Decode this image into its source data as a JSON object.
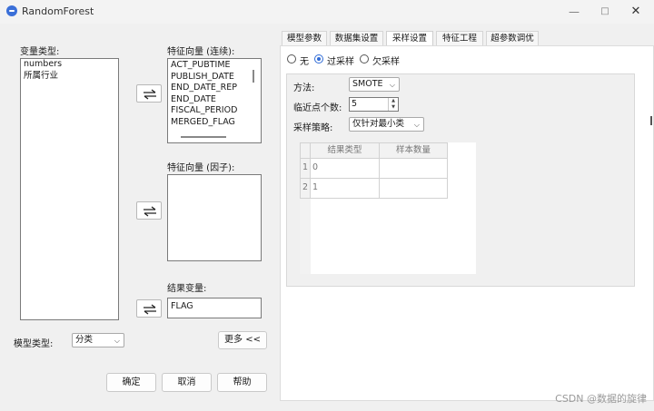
{
  "window": {
    "title": "RandomForest",
    "min_glyph": "—",
    "max_glyph": "□",
    "close_glyph": "✕"
  },
  "left": {
    "var_type_label": "变量类型:",
    "var_types": [
      "numbers",
      "所属行业"
    ],
    "continuous_label": "特征向量 (连续):",
    "continuous_items": [
      "ACT_PUBTIME",
      "PUBLISH_DATE",
      "END_DATE_REP",
      "END_DATE",
      "FISCAL_PERIOD",
      "MERGED_FLAG"
    ],
    "factor_label": "特征向量 (因子):",
    "result_label": "结果变量:",
    "result_value": "FLAG",
    "model_type_label": "模型类型:",
    "model_type_value": "分类",
    "more_button": "更多 <<",
    "ok_button": "确定",
    "cancel_button": "取消",
    "help_button": "帮助"
  },
  "tabs": [
    "模型参数",
    "数据集设置",
    "采样设置",
    "特征工程",
    "超参数调优"
  ],
  "active_tab": "采样设置",
  "sampling": {
    "radio_none": "无",
    "radio_over": "过采样",
    "radio_under": "欠采样",
    "selected": "过采样",
    "method_label": "方法:",
    "method_value": "SMOTE",
    "neighbors_label": "临近点个数:",
    "neighbors_value": "5",
    "strategy_label": "采样策略:",
    "strategy_value": "仅针对最小类",
    "table": {
      "headers": [
        "结果类型",
        "样本数量"
      ],
      "rows": [
        {
          "index": "1",
          "type": "0",
          "count": ""
        },
        {
          "index": "2",
          "type": "1",
          "count": ""
        }
      ]
    }
  },
  "watermark": "CSDN @数据的旋律",
  "colors": {
    "accent": "#2f6bd6",
    "window_bg": "#f0f0f0",
    "panel_bg": "#ffffff"
  }
}
